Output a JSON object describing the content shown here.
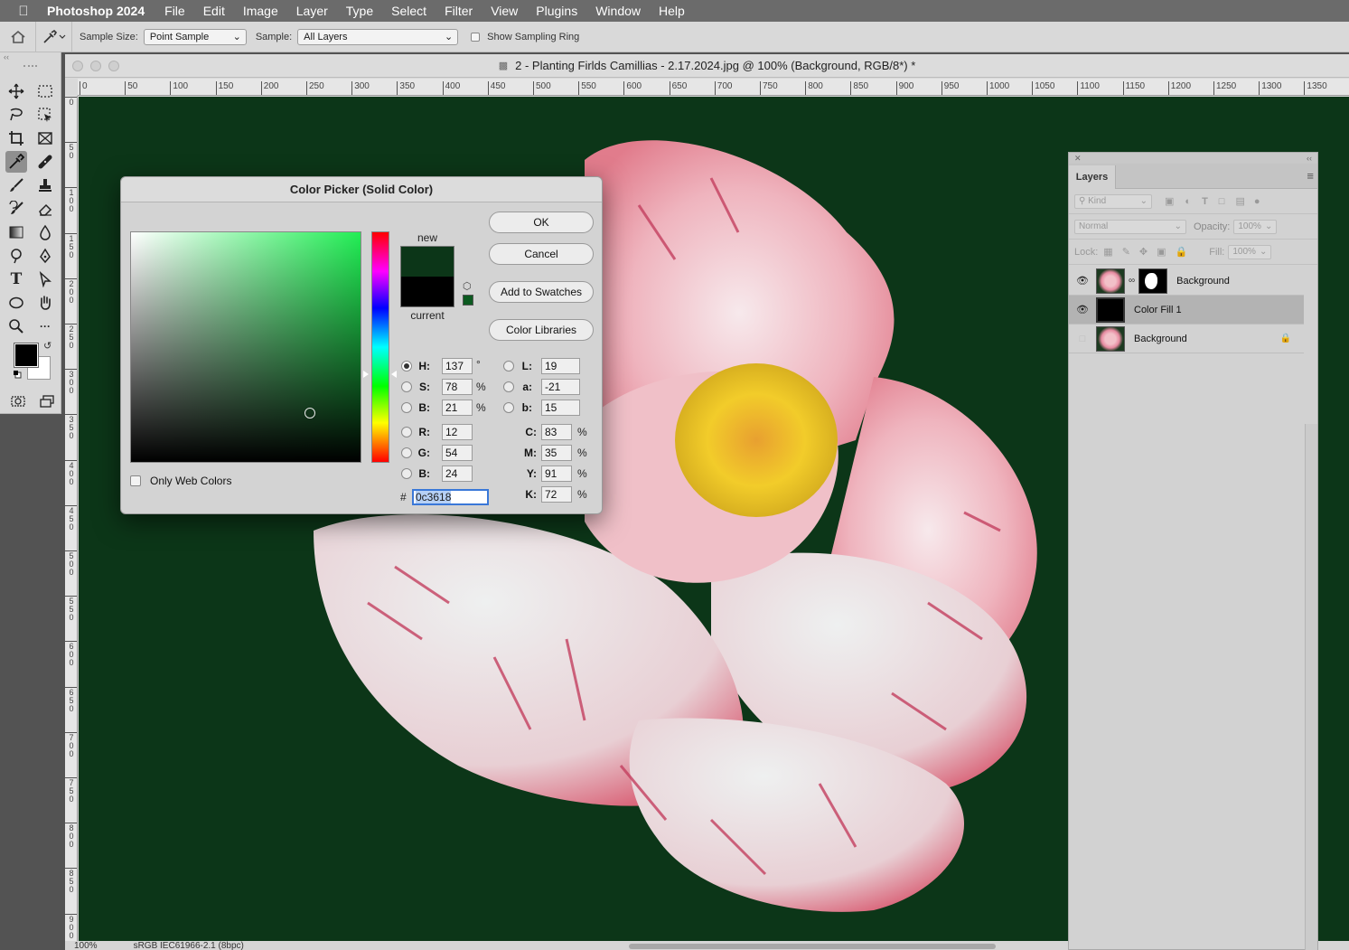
{
  "menubar": {
    "app_name": "Photoshop 2024",
    "items": [
      "File",
      "Edit",
      "Image",
      "Layer",
      "Type",
      "Select",
      "Filter",
      "View",
      "Plugins",
      "Window",
      "Help"
    ]
  },
  "options": {
    "sample_size_label": "Sample Size:",
    "sample_size_value": "Point Sample",
    "sample_label": "Sample:",
    "sample_value": "All Layers",
    "show_ring_label": "Show Sampling Ring"
  },
  "document": {
    "title": "2 - Planting Firlds Camillias - 2.17.2024.jpg @ 100% (Background, RGB/8*) *",
    "ruler_h_ticks": [
      "0",
      "50",
      "100",
      "150",
      "200",
      "250",
      "300",
      "350",
      "400",
      "450",
      "500",
      "550",
      "600",
      "650",
      "700",
      "750",
      "800",
      "850",
      "900",
      "950",
      "1000",
      "1050",
      "1100",
      "1150",
      "1200",
      "1250",
      "1300",
      "1350"
    ],
    "ruler_v_ticks": [
      "0",
      "5 0",
      "1 0 0",
      "1 5 0",
      "2 0 0",
      "2 5 0",
      "3 0 0",
      "3 5 0",
      "4 0 0",
      "4 5 0",
      "5 0 0",
      "5 5 0",
      "6 0 0",
      "6 5 0",
      "7 0 0",
      "7 5 0",
      "8 0 0",
      "8 5 0",
      "9 0 0"
    ],
    "zoom": "100%",
    "profile": "sRGB IEC61966-2.1 (8bpc)",
    "canvas_color": "#0c3618"
  },
  "layers_panel": {
    "tab_label": "Layers",
    "kind_label": "Kind",
    "blend_mode": "Normal",
    "opacity_label": "Opacity:",
    "opacity_value": "100%",
    "lock_label": "Lock:",
    "fill_label": "Fill:",
    "fill_value": "100%",
    "layers": [
      {
        "name": "Background",
        "visible": true,
        "selected": false
      },
      {
        "name": "Color Fill 1",
        "visible": true,
        "selected": true
      },
      {
        "name": "Background",
        "visible": false,
        "selected": false,
        "locked": true
      }
    ]
  },
  "color_picker": {
    "title": "Color Picker (Solid Color)",
    "new_label": "new",
    "current_label": "current",
    "new_color": "#0c3618",
    "current_color": "#000000",
    "ok_label": "OK",
    "cancel_label": "Cancel",
    "add_swatches_label": "Add to Swatches",
    "color_libraries_label": "Color Libraries",
    "only_web_label": "Only Web Colors",
    "hex_label": "#",
    "hex": "0c3618",
    "h": {
      "label": "H:",
      "value": "137",
      "unit": "°"
    },
    "s": {
      "label": "S:",
      "value": "78",
      "unit": "%"
    },
    "b": {
      "label": "B:",
      "value": "21",
      "unit": "%"
    },
    "r": {
      "label": "R:",
      "value": "12"
    },
    "g": {
      "label": "G:",
      "value": "54"
    },
    "blue": {
      "label": "B:",
      "value": "24"
    },
    "l": {
      "label": "L:",
      "value": "19"
    },
    "a": {
      "label": "a:",
      "value": "-21"
    },
    "lab_b": {
      "label": "b:",
      "value": "15"
    },
    "c": {
      "label": "C:",
      "value": "83",
      "unit": "%"
    },
    "m": {
      "label": "M:",
      "value": "35",
      "unit": "%"
    },
    "y": {
      "label": "Y:",
      "value": "91",
      "unit": "%"
    },
    "k": {
      "label": "K:",
      "value": "72",
      "unit": "%"
    }
  }
}
